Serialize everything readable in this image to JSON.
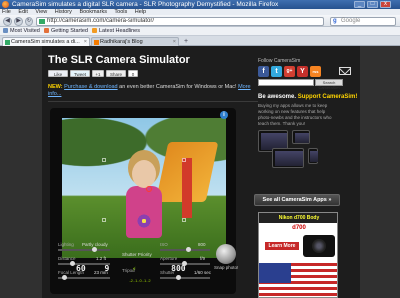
{
  "window": {
    "title": "CameraSim simulates a digital SLR camera - SLR Photography Demystified - Mozilla Firefox",
    "controls": [
      "_",
      "□",
      "x"
    ]
  },
  "menu": {
    "items": [
      "File",
      "Edit",
      "View",
      "History",
      "Bookmarks",
      "Tools",
      "Help"
    ]
  },
  "nav": {
    "back": "◀",
    "forward": "▶",
    "url": "http://camerasim.com/camera-simulator/",
    "search_placeholder": "Google"
  },
  "bookmarks": {
    "items": [
      "Most Visited",
      "Getting Started",
      "Latest Headlines"
    ]
  },
  "tabs": [
    {
      "label": "CameraSim simulates a di..."
    },
    {
      "label": "Radhikaraj's Blog"
    }
  ],
  "page": {
    "title": "The SLR Camera Simulator",
    "share": [
      "Like",
      "Tweet",
      "+1",
      "Share",
      "0"
    ],
    "new_label": "NEW:",
    "new_link": "Purchase & download",
    "new_text": " an even better CameraSim for Windows or Mac!",
    "more_link": "More info..."
  },
  "camera": {
    "readout": {
      "shutter": "60",
      "aperture": "9",
      "iso": "800"
    },
    "scale": "-2..1..0..1..2",
    "info_icon": "i",
    "controls": {
      "lighting": "Lighting",
      "lighting_val": "Partly cloudy",
      "distance": "Distance",
      "distance_val": "1.2 ft",
      "focal": "Focal Length",
      "focal_val": "23 mm",
      "iso": "ISO",
      "iso_val": "800",
      "mode": "Shutter Priority",
      "aperture": "Aperture",
      "aperture_val": "f/9",
      "shutter": "Shutter",
      "shutter_val": "1/60 sec",
      "tripod": "Tripod"
    },
    "snap_label": "Snap photo!"
  },
  "sidebar": {
    "follow": "Follow CameraSim",
    "social": [
      "f",
      "t",
      "g+",
      "Y",
      "rss"
    ],
    "search_btn": "Search CameraSim",
    "search_placeholder": "",
    "awesome_bold": "Be awesome.",
    "awesome_yellow": " Support CameraSim!",
    "text": "Buying my apps allows me to keep working on new features that help photo-newbs and the instructors who teach them. Thank you!",
    "see_all": "See all CameraSim Apps »"
  },
  "ad": {
    "head": "Nikon d700 Body",
    "title": "d700",
    "btn": "Learn More",
    "model": ""
  },
  "colors": {
    "accent": "#ffd400",
    "link": "#6fb6ff",
    "page_bg": "#1d1d1d"
  }
}
